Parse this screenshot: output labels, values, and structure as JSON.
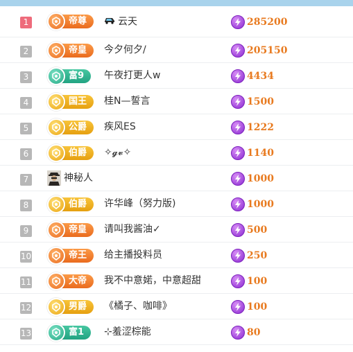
{
  "colors": {
    "header_bar": "#a9d3ec",
    "rank_default": "#b7b7b7",
    "rank_first": "#ee6b7b",
    "score_text": "#e87a1f",
    "coin": "#8b2bd1"
  },
  "leaderboard": {
    "rows": [
      {
        "rank": "1",
        "badge": "帝尊",
        "tier": "orange",
        "name": "云天",
        "name_icon": "car-icon",
        "score": "285200"
      },
      {
        "rank": "2",
        "badge": "帝皇",
        "tier": "orange",
        "name": "今夕何夕/",
        "score": "205150"
      },
      {
        "rank": "3",
        "badge": "富9",
        "tier": "teal",
        "name": "午夜打更人w",
        "score": "4434"
      },
      {
        "rank": "4",
        "badge": "国王",
        "tier": "gold",
        "name": "桂N—誓言",
        "score": "1500"
      },
      {
        "rank": "5",
        "badge": "公爵",
        "tier": "gold",
        "name": "疾风ES",
        "score": "1222"
      },
      {
        "rank": "6",
        "badge": "伯爵",
        "tier": "gold",
        "name": "✧𝓰𝓿✧",
        "score": "1140"
      },
      {
        "rank": "7",
        "badge": "",
        "tier": "",
        "name": "神秘人",
        "avatar": "mystery-user-avatar",
        "score": "1000"
      },
      {
        "rank": "8",
        "badge": "伯爵",
        "tier": "gold",
        "name": "许华峰（努力版)",
        "score": "1000"
      },
      {
        "rank": "9",
        "badge": "帝皇",
        "tier": "orange",
        "name": "请叫我酱油✓",
        "score": "500"
      },
      {
        "rank": "10",
        "badge": "帝王",
        "tier": "orange",
        "name": "给主播投料员",
        "score": "250"
      },
      {
        "rank": "11",
        "badge": "大帝",
        "tier": "orange",
        "name": "我不中意婼，中意超甜",
        "score": "100"
      },
      {
        "rank": "12",
        "badge": "男爵",
        "tier": "gold",
        "name": "《橘子、咖啡》",
        "score": "100"
      },
      {
        "rank": "13",
        "badge": "富1",
        "tier": "teal",
        "name": "⊹羞涩棕能",
        "score": "80"
      }
    ]
  }
}
